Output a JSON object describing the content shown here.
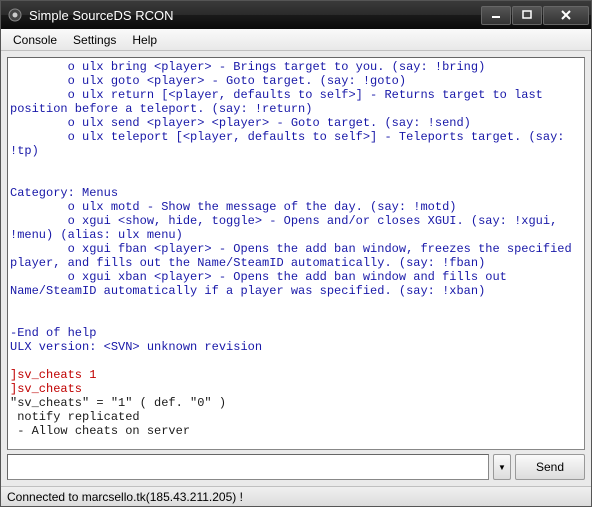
{
  "window": {
    "title": "Simple SourceDS RCON"
  },
  "menubar": {
    "items": [
      "Console",
      "Settings",
      "Help"
    ]
  },
  "console": {
    "lines": [
      {
        "cls": "l-blue",
        "text": "        o ulx bring <player> - Brings target to you. (say: !bring)"
      },
      {
        "cls": "l-blue",
        "text": "        o ulx goto <player> - Goto target. (say: !goto)"
      },
      {
        "cls": "l-blue",
        "text": "        o ulx return [<player, defaults to self>] - Returns target to last position before a teleport. (say: !return)"
      },
      {
        "cls": "l-blue",
        "text": "        o ulx send <player> <player> - Goto target. (say: !send)"
      },
      {
        "cls": "l-blue",
        "text": "        o ulx teleport [<player, defaults to self>] - Teleports target. (say: !tp)"
      },
      {
        "cls": "l-blue",
        "text": ""
      },
      {
        "cls": "l-blue",
        "text": ""
      },
      {
        "cls": "l-blue",
        "text": "Category: Menus"
      },
      {
        "cls": "l-blue",
        "text": "        o ulx motd - Show the message of the day. (say: !motd)"
      },
      {
        "cls": "l-blue",
        "text": "        o xgui <show, hide, toggle> - Opens and/or closes XGUI. (say: !xgui, !menu) (alias: ulx menu)"
      },
      {
        "cls": "l-blue",
        "text": "        o xgui fban <player> - Opens the add ban window, freezes the specified player, and fills out the Name/SteamID automatically. (say: !fban)"
      },
      {
        "cls": "l-blue",
        "text": "        o xgui xban <player> - Opens the add ban window and fills out Name/SteamID automatically if a player was specified. (say: !xban)"
      },
      {
        "cls": "l-blue",
        "text": ""
      },
      {
        "cls": "l-blue",
        "text": ""
      },
      {
        "cls": "l-blue",
        "text": "-End of help"
      },
      {
        "cls": "l-blue",
        "text": "ULX version: <SVN> unknown revision"
      },
      {
        "cls": "l-blue",
        "text": ""
      },
      {
        "cls": "l-red",
        "text": "]sv_cheats 1"
      },
      {
        "cls": "l-red",
        "text": "]sv_cheats"
      },
      {
        "cls": "l-dark",
        "text": "\"sv_cheats\" = \"1\" ( def. \"0\" )"
      },
      {
        "cls": "l-dark",
        "text": " notify replicated"
      },
      {
        "cls": "l-dark",
        "text": " - Allow cheats on server"
      }
    ]
  },
  "input": {
    "value": "",
    "placeholder": ""
  },
  "buttons": {
    "send": "Send",
    "dropdown_glyph": "▼"
  },
  "status": {
    "text": "Connected to marcsello.tk(185.43.211.205) !"
  }
}
